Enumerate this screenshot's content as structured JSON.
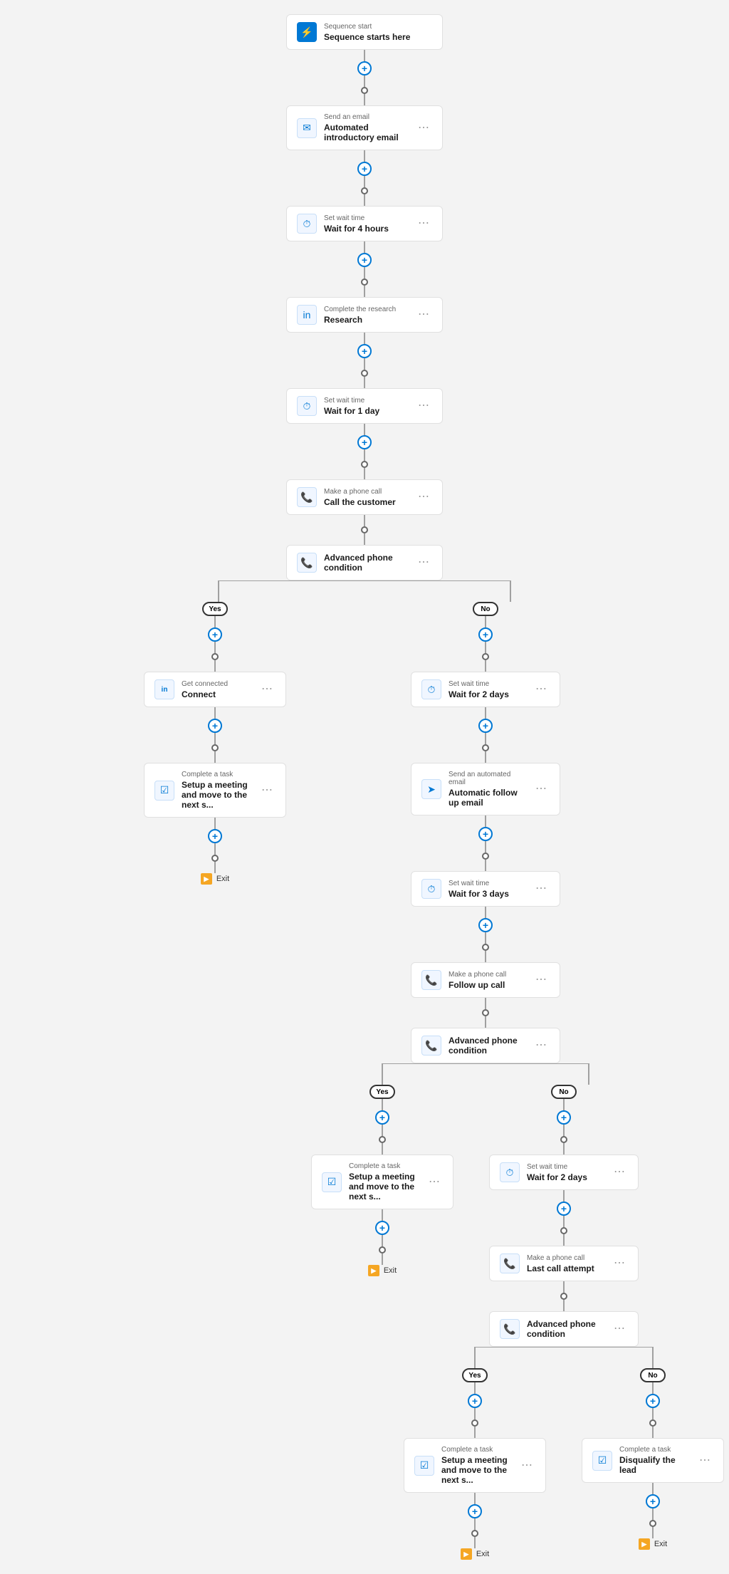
{
  "nodes": {
    "sequence_start": {
      "label": "Sequence start",
      "title": "Sequence starts here"
    },
    "send_email_1": {
      "label": "Send an email",
      "title": "Automated introductory email"
    },
    "wait_4h": {
      "label": "Set wait time",
      "title": "Wait for 4 hours"
    },
    "research": {
      "label": "Complete the research",
      "title": "Research"
    },
    "wait_1d": {
      "label": "Set wait time",
      "title": "Wait for 1 day"
    },
    "call_customer": {
      "label": "Make a phone call",
      "title": "Call the customer"
    },
    "phone_condition_1": {
      "label": "",
      "title": "Advanced phone condition"
    },
    "yes_connect": {
      "label": "Get connected",
      "title": "Connect"
    },
    "task_setup_meeting_1": {
      "label": "Complete a task",
      "title": "Setup a meeting and move to the next s..."
    },
    "exit_1": {
      "label": "Exit",
      "title": "Exit"
    },
    "wait_2d_1": {
      "label": "Set wait time",
      "title": "Wait for 2 days"
    },
    "auto_followup_email": {
      "label": "Send an automated email",
      "title": "Automatic follow up email"
    },
    "wait_3d": {
      "label": "Set wait time",
      "title": "Wait for 3 days"
    },
    "followup_call": {
      "label": "Make a phone call",
      "title": "Follow up call"
    },
    "phone_condition_2": {
      "label": "",
      "title": "Advanced phone condition"
    },
    "task_setup_meeting_2": {
      "label": "Complete a task",
      "title": "Setup a meeting and move to the next s..."
    },
    "exit_2": {
      "label": "Exit",
      "title": "Exit"
    },
    "wait_2d_2": {
      "label": "Set wait time",
      "title": "Wait for 2 days"
    },
    "last_call": {
      "label": "Make a phone call",
      "title": "Last call attempt"
    },
    "phone_condition_3": {
      "label": "",
      "title": "Advanced phone condition"
    },
    "task_setup_meeting_3": {
      "label": "Complete a task",
      "title": "Setup a meeting and move to the next s..."
    },
    "disqualify_lead": {
      "label": "Complete a task",
      "title": "Disqualify the lead"
    },
    "exit_3": {
      "label": "Exit",
      "title": "Exit"
    },
    "exit_4": {
      "label": "Exit",
      "title": "Exit"
    }
  },
  "labels": {
    "yes": "Yes",
    "no": "No",
    "plus": "+",
    "ellipsis": "⋯"
  },
  "colors": {
    "blue": "#0078d4",
    "light_blue_bg": "#f0f6ff",
    "orange": "#f5a623",
    "border": "#e0e0e0",
    "line": "#a0a0a0"
  }
}
